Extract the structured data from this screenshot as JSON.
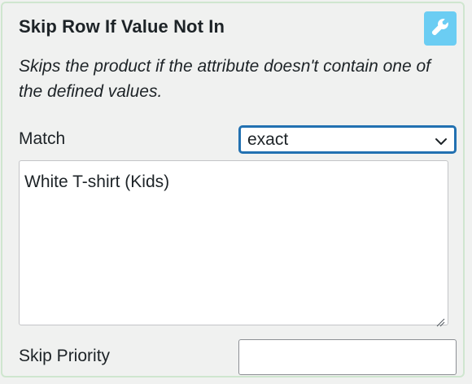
{
  "panel": {
    "title": "Skip Row If Value Not In",
    "settings_icon": "wrench-icon",
    "description": "Skips the product if the attribute doesn't contain one of the defined values.",
    "match": {
      "label": "Match",
      "selected": "exact"
    },
    "values": {
      "text": "White T-shirt (Kids)"
    },
    "skip_priority": {
      "label": "Skip Priority",
      "value": ""
    }
  },
  "colors": {
    "settings_button": "#6bcdf3",
    "focus_border": "#2271b1",
    "panel_border": "#cfe6cf"
  }
}
